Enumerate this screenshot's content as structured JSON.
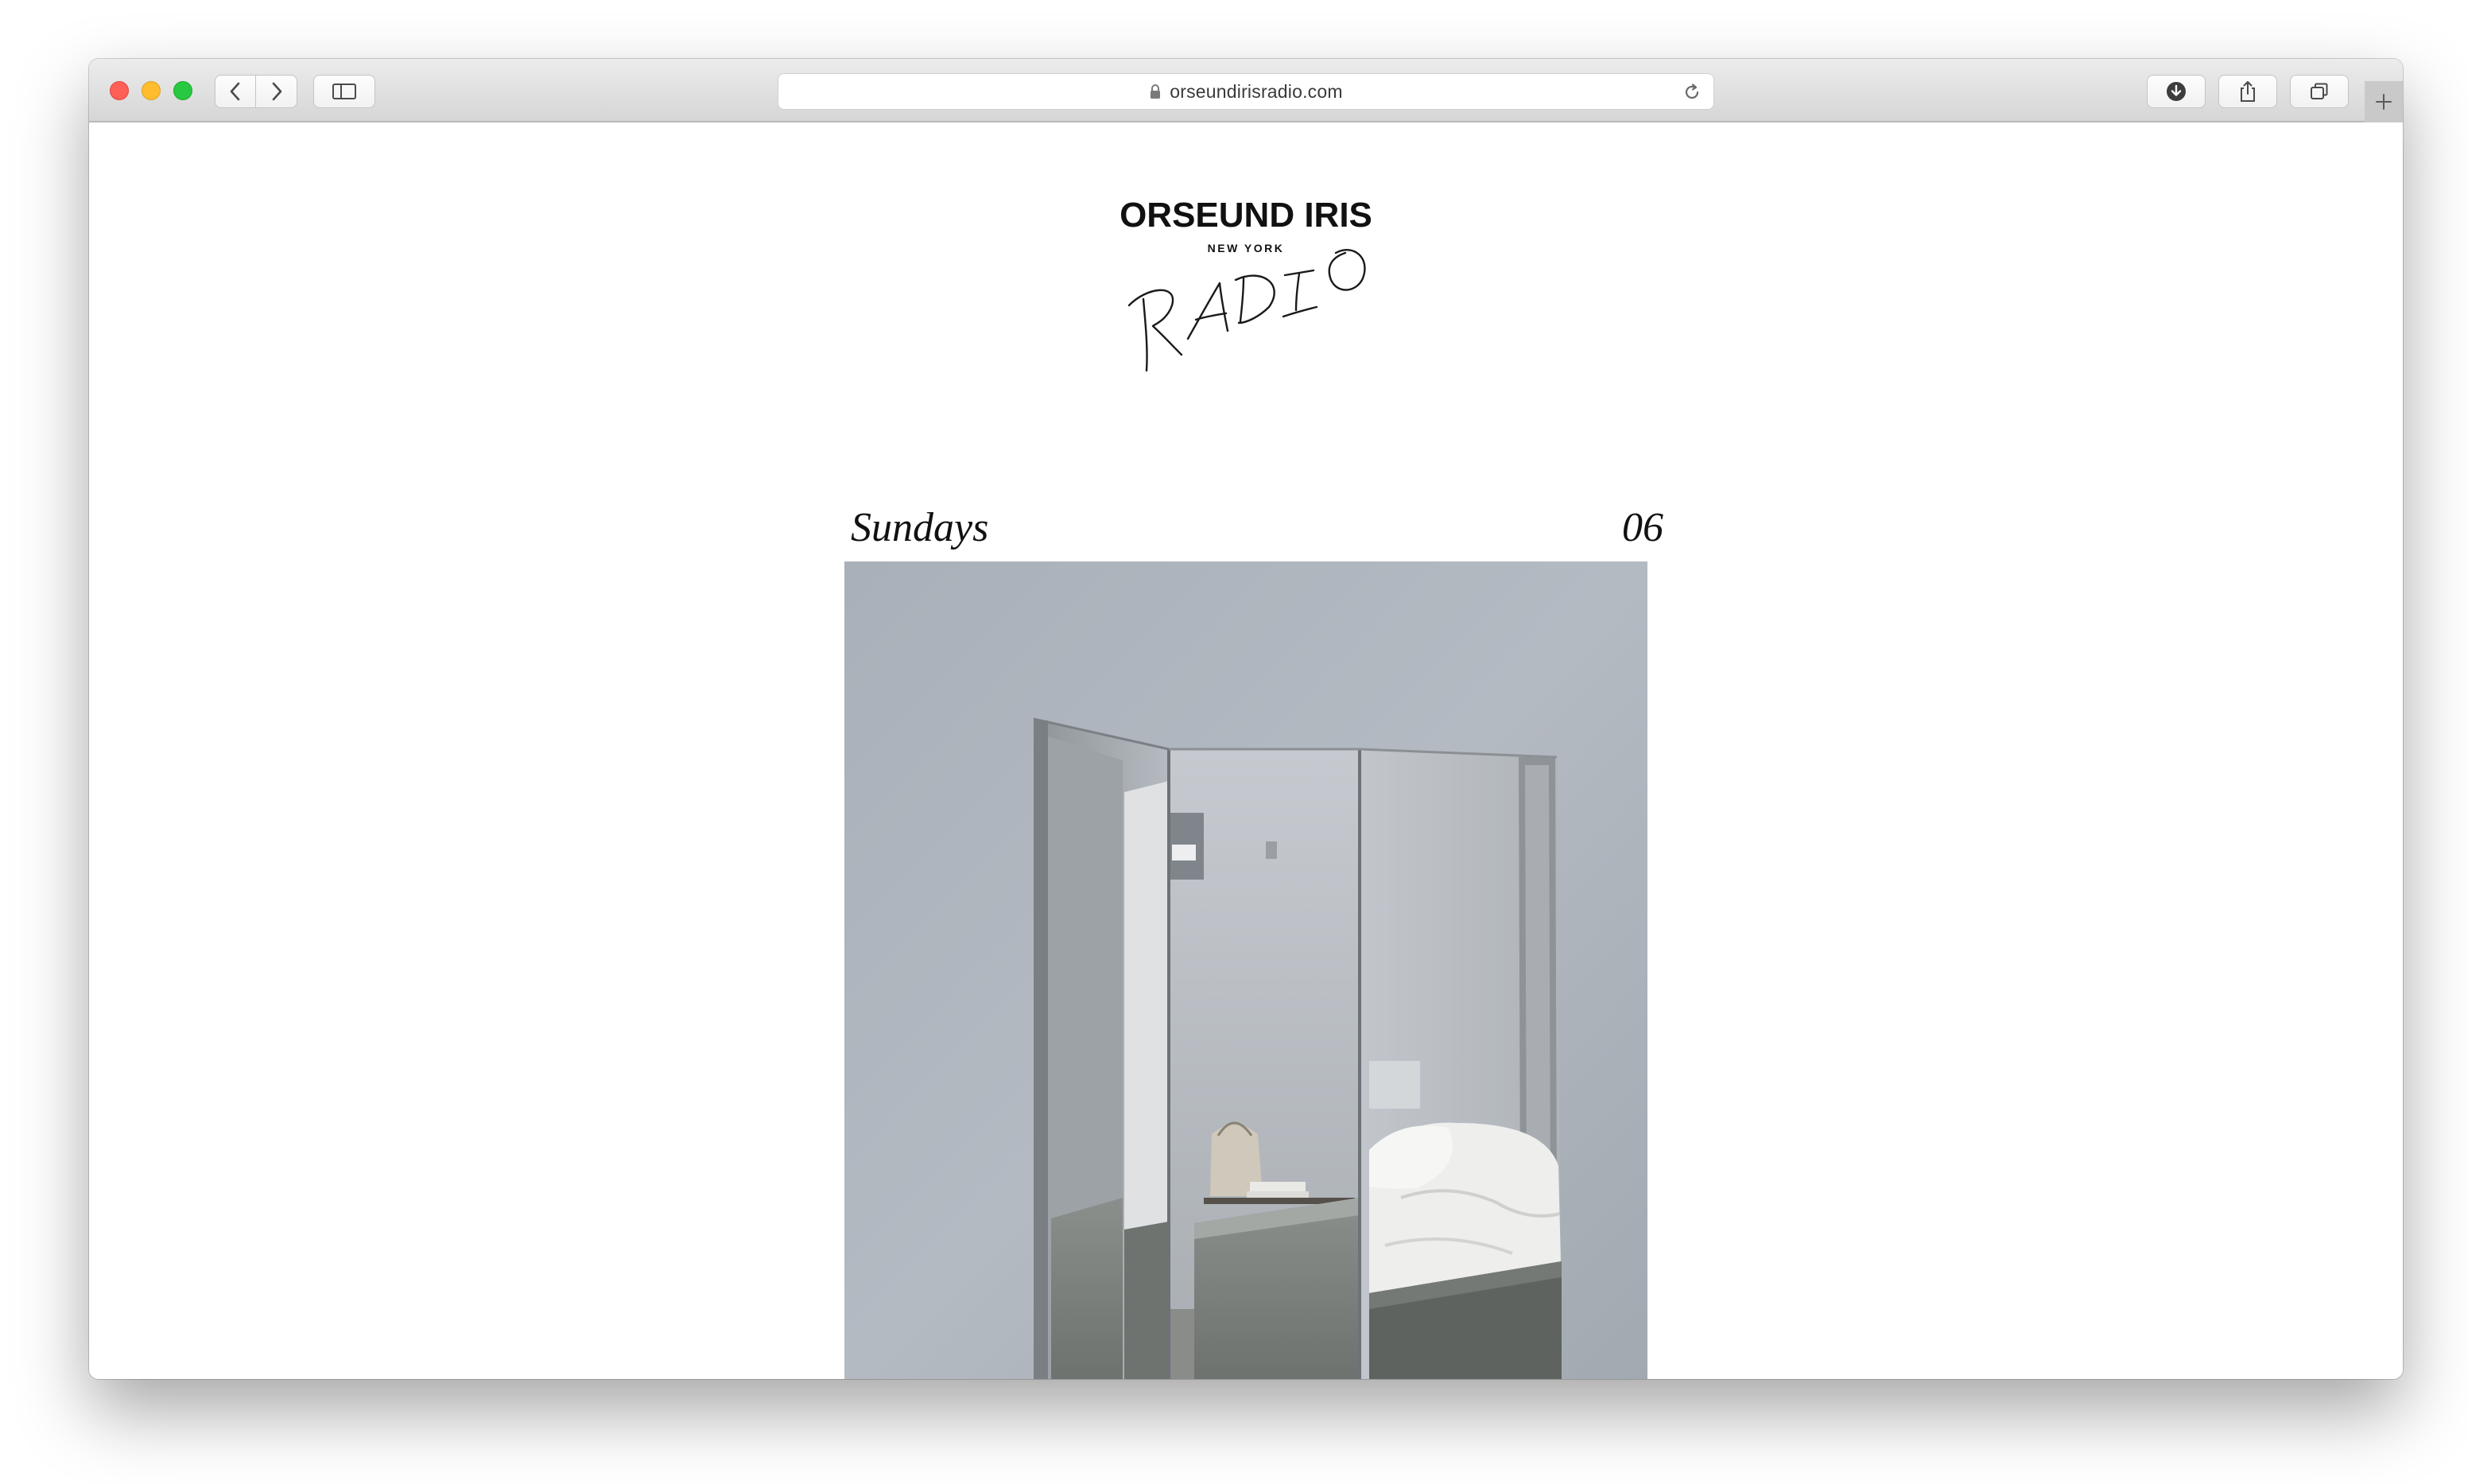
{
  "browser": {
    "url": "orseundirisradio.com"
  },
  "page": {
    "brand": {
      "title": "ORSEUND IRIS",
      "location": "NEW YORK",
      "signature": "RADIO"
    },
    "section": {
      "label": "Sundays",
      "number": "06"
    },
    "image": {
      "subject": "three-panel mirrored screen in a minimalist bedroom with concrete bathtub"
    }
  }
}
